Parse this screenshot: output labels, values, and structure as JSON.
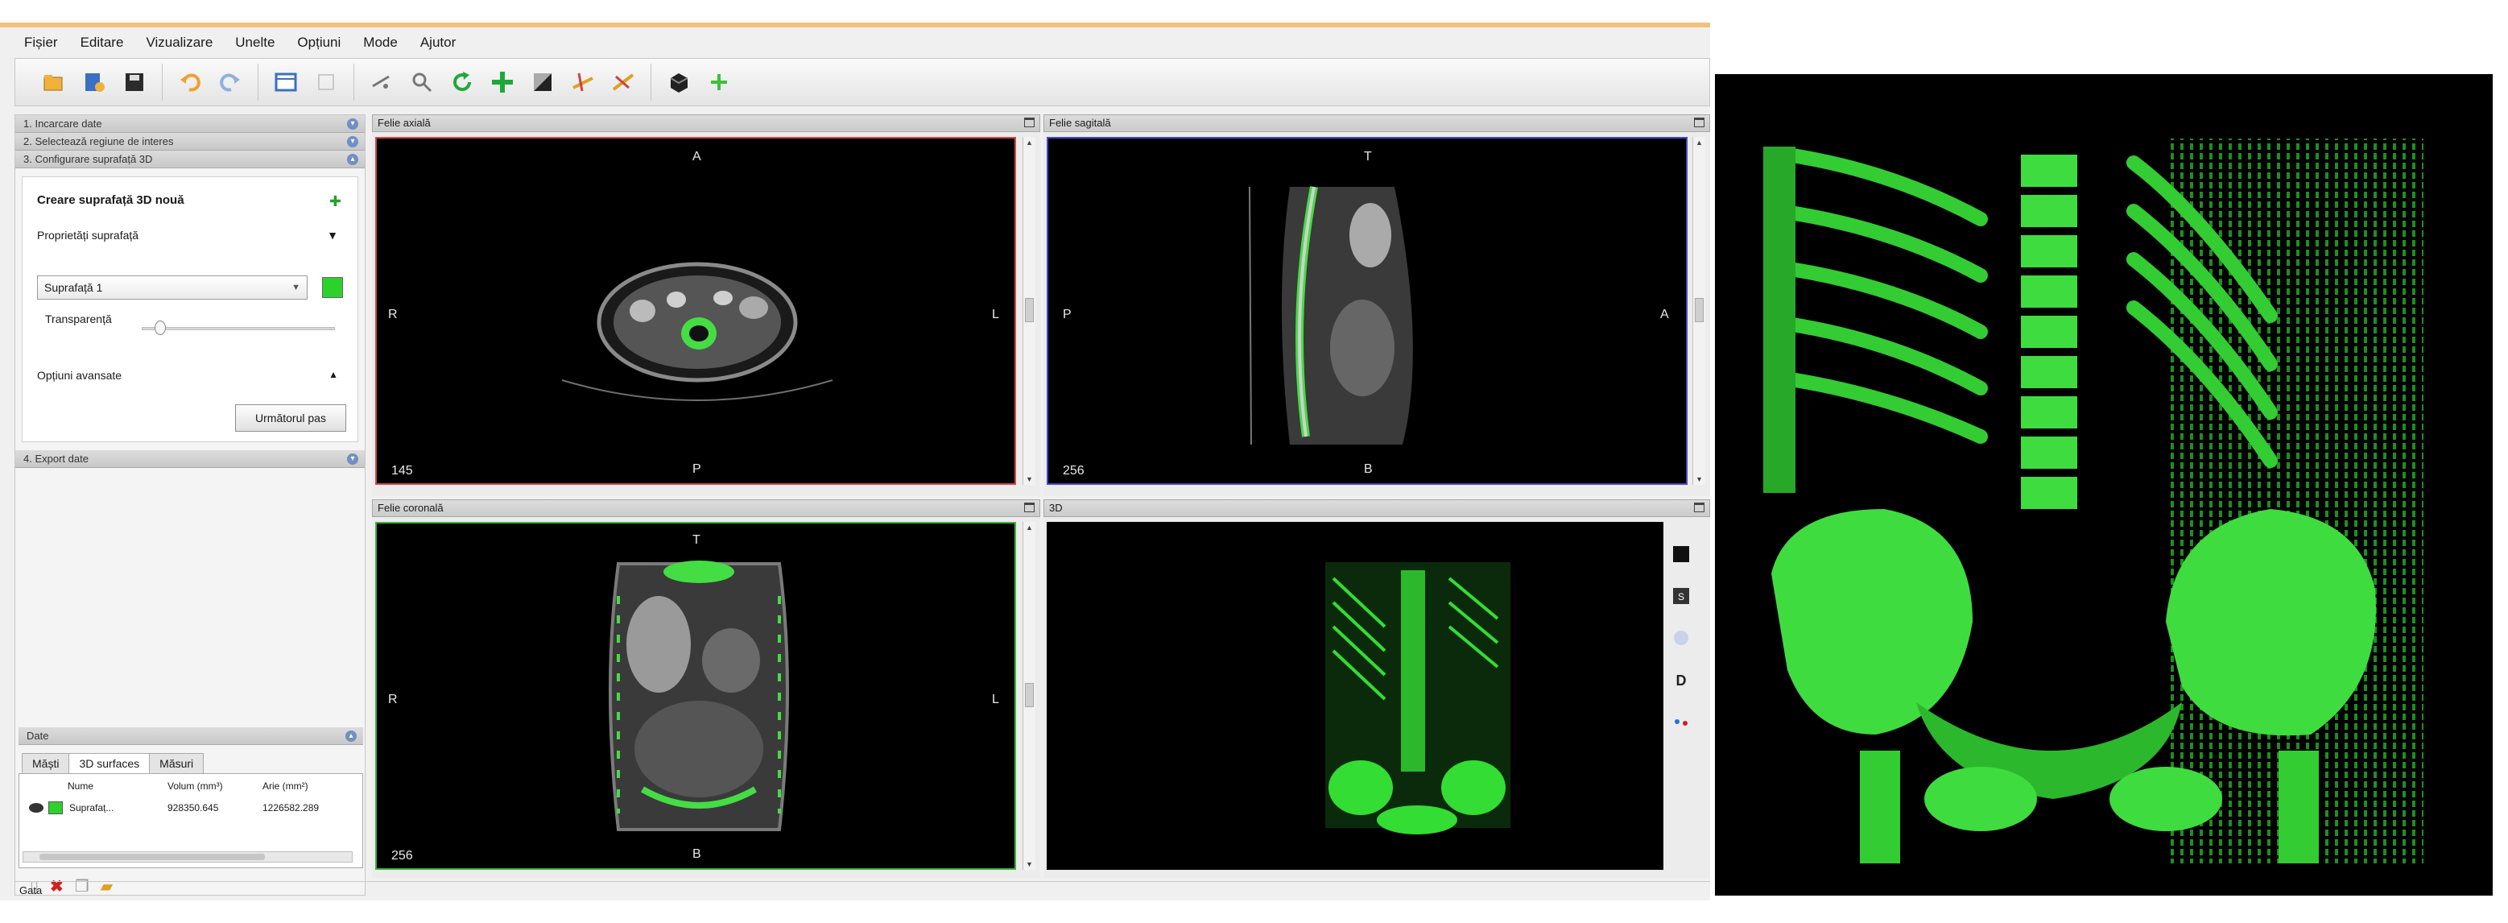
{
  "menu": [
    "Fișier",
    "Editare",
    "Vizualizare",
    "Unelte",
    "Opțiuni",
    "Mode",
    "Ajutor"
  ],
  "toolbar": {
    "groups": [
      [
        "open-icon",
        "import-icon",
        "save-icon"
      ],
      [
        "undo-icon",
        "redo-icon"
      ],
      [
        "layout-icon",
        "layout-alt-icon"
      ],
      [
        "pan-icon",
        "zoom-icon",
        "rotate-icon",
        "crosshair-icon",
        "contrast-icon",
        "measure-icon",
        "ruler-icon"
      ],
      [
        "view3d-icon",
        "add-icon"
      ]
    ]
  },
  "left": {
    "sections": [
      "1. Incarcare date",
      "2. Selectează regiune de interes",
      "3. Configurare suprafață 3D"
    ],
    "card": {
      "title": "Creare suprafață 3D nouă",
      "properties": "Proprietăți suprafață",
      "surface_select": "Suprafață 1",
      "transparency": "Transparență",
      "advanced": "Opțiuni avansate",
      "next": "Următorul pas"
    },
    "export": "4. Export date",
    "data_header": "Date",
    "tabs": [
      "Măști",
      "3D surfaces",
      "Măsuri"
    ],
    "table_headers": [
      "Nume",
      "Volum (mm³)",
      "Arie (mm²)"
    ],
    "row": {
      "name": "Suprafaț...",
      "volume": "928350.645",
      "area": "1226582.289"
    }
  },
  "views": {
    "axial": {
      "title": "Felie axială",
      "top": "A",
      "bottom": "P",
      "left": "R",
      "right": "L",
      "slice": "145"
    },
    "sagittal": {
      "title": "Felie sagitală",
      "top": "T",
      "bottom": "B",
      "left": "P",
      "right": "A",
      "slice": "256"
    },
    "coronal": {
      "title": "Felie coronală",
      "top": "T",
      "bottom": "B",
      "left": "R",
      "right": "L",
      "slice": "256"
    },
    "volume": {
      "title": "3D"
    }
  },
  "status": "Gata",
  "colors": {
    "surface_green": "#2cd22c",
    "background": "#000000",
    "window_border": "#f2c27a"
  }
}
